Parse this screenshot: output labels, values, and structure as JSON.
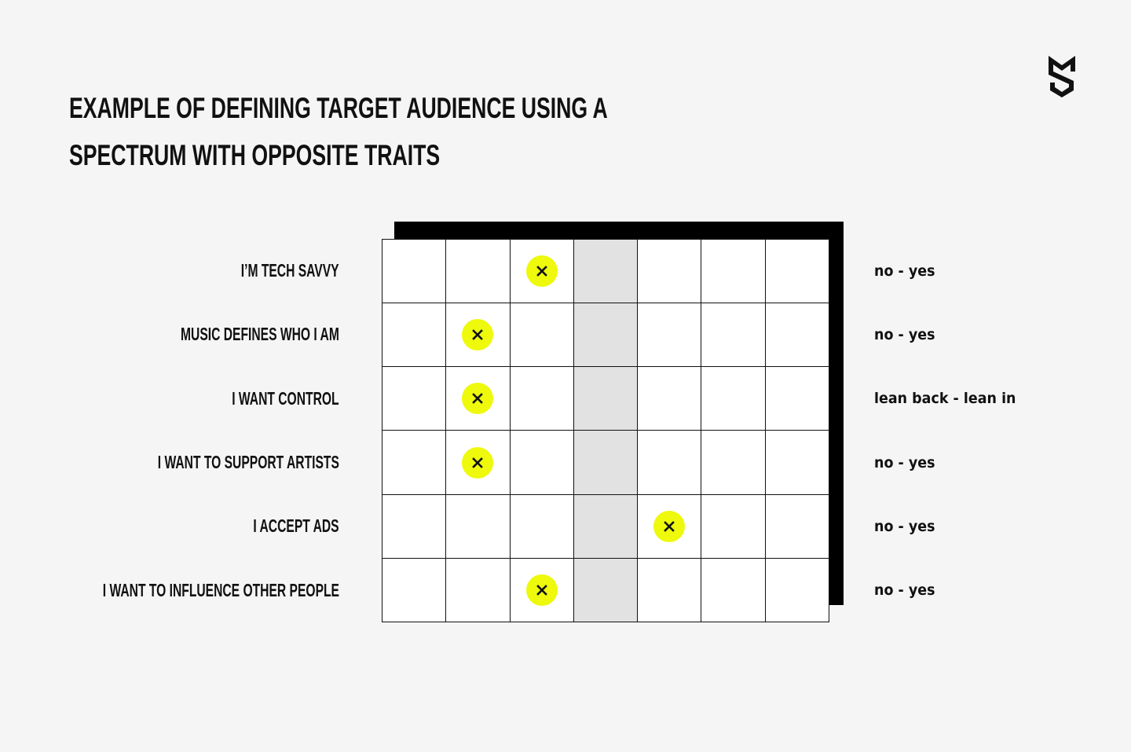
{
  "title": {
    "line1": "EXAMPLE OF DEFINING TARGET AUDIENCE USING A",
    "line2": "SPECTRUM WITH OPPOSITE TRAITS"
  },
  "logo": {
    "icon": "brand-logo-icon"
  },
  "colors": {
    "background": "#f5f5f5",
    "marker": "#eef90c",
    "neutral_column": "#e2e2e2",
    "grid_line": "#111111",
    "shadow": "#000000"
  },
  "spectrum": {
    "columns": 7,
    "neutral_column": 4,
    "marker_symbol": "×",
    "rows": [
      {
        "trait": "I’M TECH SAVVY",
        "scale": "no - yes",
        "position": 3
      },
      {
        "trait": "MUSIC DEFINES WHO I AM",
        "scale": "no - yes",
        "position": 2
      },
      {
        "trait": "I WANT CONTROL",
        "scale": "lean back - lean in",
        "position": 2
      },
      {
        "trait": "I WANT TO SUPPORT ARTISTS",
        "scale": "no - yes",
        "position": 2
      },
      {
        "trait": "I ACCEPT ADS",
        "scale": "no - yes",
        "position": 5
      },
      {
        "trait": "I WANT TO INFLUENCE OTHER PEOPLE",
        "scale": "no - yes",
        "position": 3
      }
    ]
  }
}
